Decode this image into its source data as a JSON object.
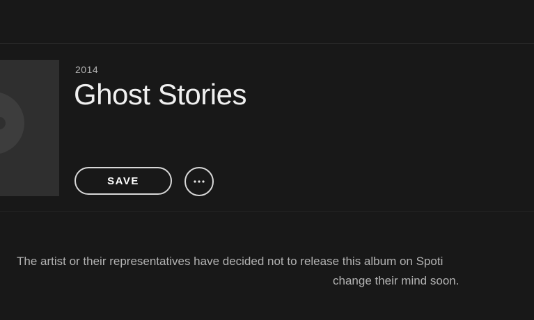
{
  "album": {
    "year": "2014",
    "title": "Ghost Stories"
  },
  "actions": {
    "save_label": "SAVE",
    "more_icon": "ellipsis-icon"
  },
  "notice": {
    "line1": "The artist or their representatives have decided not to release this album on Spoti",
    "line2": "change their mind soon."
  },
  "colors": {
    "background": "#181818",
    "text_primary": "#f0f0f0",
    "text_secondary": "#b3b3b3",
    "button_border": "#d8d8d8"
  }
}
